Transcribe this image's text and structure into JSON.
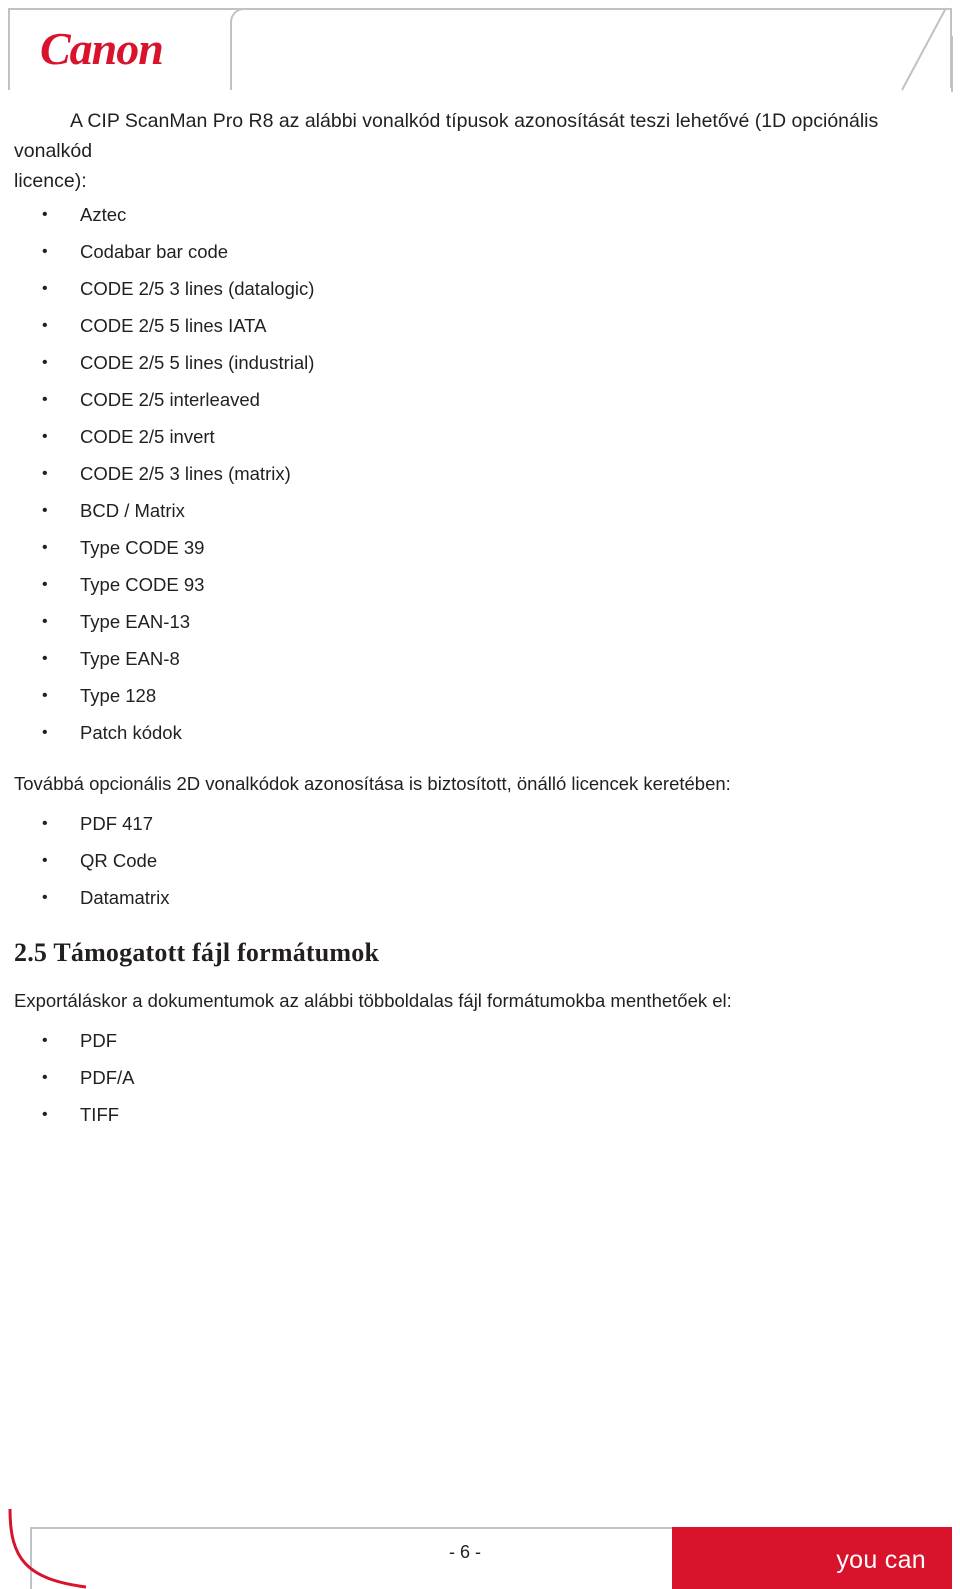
{
  "header": {
    "logo_text": "Canon",
    "logo_color": "#d9132b"
  },
  "document": {
    "intro_line_prefix": "A CIP ScanMan Pro R8 az alábbi vonalkód típusok azonosítását teszi lehetővé (1D opciónális vonalkód",
    "intro_line_suffix": "licence):",
    "barcode_1d_list": [
      "Aztec",
      "Codabar bar code",
      "CODE 2/5 3 lines (datalogic)",
      "CODE 2/5 5 lines IATA",
      "CODE 2/5 5 lines (industrial)",
      "CODE 2/5 interleaved",
      "CODE 2/5 invert",
      "CODE 2/5 3 lines (matrix)",
      "BCD / Matrix",
      "Type CODE 39",
      "Type CODE 93",
      "Type EAN-13",
      "Type EAN-8",
      "Type 128",
      "Patch kódok"
    ],
    "para_2d": "Továbbá opcionális 2D vonalkódok azonosítása is biztosított, önálló licencek keretében:",
    "barcode_2d_list": [
      "PDF 417",
      "QR Code",
      "Datamatrix"
    ],
    "section_title": "2.5 Támogatott fájl formátumok",
    "para_export": "Exportáláskor a dokumentumok az alábbi többoldalas fájl formátumokba menthetőek el:",
    "file_format_list": [
      "PDF",
      "PDF/A",
      "TIFF"
    ]
  },
  "footer": {
    "page_number": "- 6 -",
    "tagline": "you can",
    "accent_color": "#d9132b"
  }
}
